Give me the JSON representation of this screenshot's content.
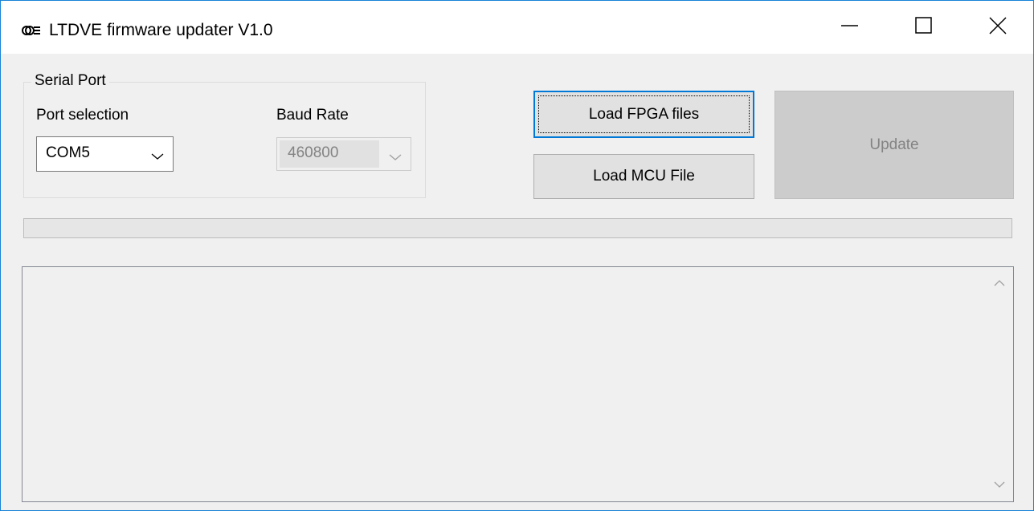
{
  "window": {
    "title": "LTDVE firmware updater V1.0",
    "app_icon": "app-logo-icon",
    "controls": {
      "minimize_icon": "minimize-icon",
      "maximize_icon": "maximize-icon",
      "close_icon": "close-icon"
    }
  },
  "serial_port": {
    "group_label": "Serial Port",
    "port_label": "Port selection",
    "port_value": "COM5",
    "baud_label": "Baud Rate",
    "baud_value": "460800",
    "baud_enabled": false
  },
  "actions": {
    "load_fpga_label": "Load FPGA files",
    "load_mcu_label": "Load MCU File",
    "update_label": "Update",
    "update_enabled": false
  },
  "progress": {
    "value": 0
  },
  "log": {
    "text": "",
    "scroll_up_icon": "scroll-up-icon",
    "scroll_down_icon": "scroll-down-icon"
  },
  "colors": {
    "accent": "#0078d7",
    "window_border": "#1883d7",
    "disabled_text": "#838383",
    "background": "#f0f0f0"
  }
}
